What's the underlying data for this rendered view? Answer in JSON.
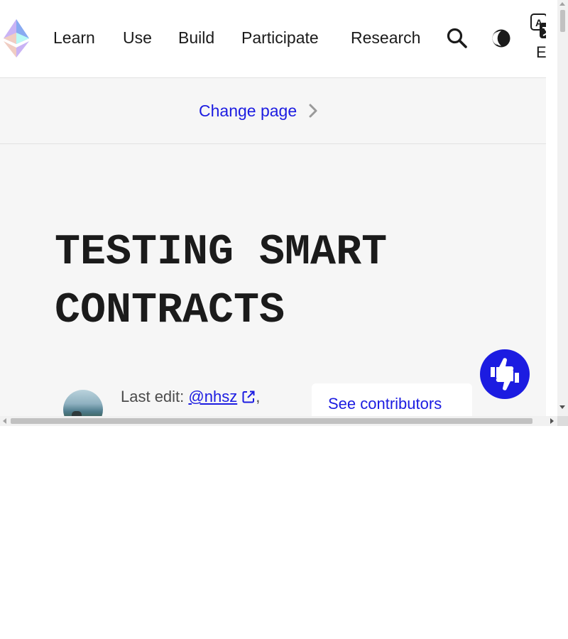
{
  "nav": {
    "links": [
      "Learn",
      "Use",
      "Build",
      "Participate",
      "Research"
    ],
    "language": "EN",
    "icons": {
      "logo": "ethereum-logo",
      "search": "search-icon",
      "theme": "dark-mode-icon",
      "language": "translate-icon"
    }
  },
  "change_page": {
    "label": "Change page",
    "icon": "chevron-right-icon"
  },
  "article": {
    "title": "TESTING SMART CONTRACTS",
    "last_edit_label": "Last edit:",
    "editor": "@nhsz",
    "after_editor": ",",
    "contributors_button": "See contributors"
  },
  "feedback": {
    "icon": "thumbs-up-down-icon"
  },
  "colors": {
    "accent": "#1c1ce1",
    "text": "#1b1b1b",
    "muted_text": "#4b4b4b",
    "hero_bg": "#f6f6f6"
  }
}
